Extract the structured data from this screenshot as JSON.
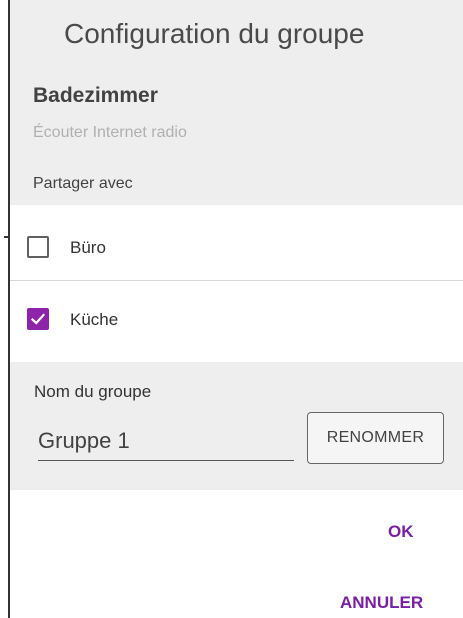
{
  "dialog": {
    "title": "Configuration du groupe",
    "zone_name": "Badezimmer",
    "zone_subtitle": "Écouter Internet radio",
    "share_label": "Partager avec"
  },
  "share_options": [
    {
      "label": "Büro",
      "checked": false
    },
    {
      "label": "Küche",
      "checked": true
    }
  ],
  "group": {
    "name_label": "Nom du groupe",
    "name_value": "Gruppe 1",
    "rename_label": "RENOMMER"
  },
  "actions": {
    "ok_label": "OK",
    "cancel_label": "ANNULER"
  },
  "colors": {
    "accent": "#8e24aa",
    "header_bg": "#eeeeee"
  }
}
